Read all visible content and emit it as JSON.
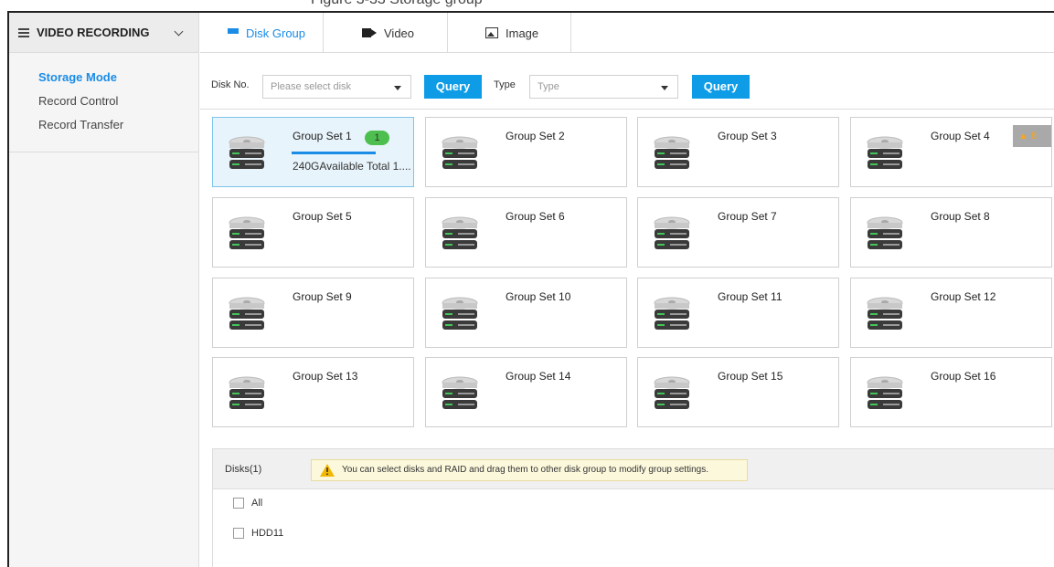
{
  "caption": "Figure 3-33 Storage group",
  "sidebar": {
    "title": "VIDEO RECORDING",
    "items": [
      {
        "label": "Storage Mode",
        "active": true
      },
      {
        "label": "Record Control",
        "active": false
      },
      {
        "label": "Record Transfer",
        "active": false
      }
    ]
  },
  "tabs": [
    {
      "label": "Disk Group",
      "icon": "list-icon",
      "active": true
    },
    {
      "label": "Video",
      "icon": "video-camera-icon",
      "active": false
    },
    {
      "label": "Image",
      "icon": "image-icon",
      "active": false
    }
  ],
  "filter": {
    "disk_label": "Disk No.",
    "disk_placeholder": "Please select disk",
    "query1": "Query",
    "type_label": "Type",
    "type_placeholder": "Type",
    "query2": "Query"
  },
  "groups": [
    {
      "name": "Group Set 1",
      "badge": "1",
      "subtext": "240GAvailable Total 1....",
      "selected": true
    },
    {
      "name": "Group Set 2"
    },
    {
      "name": "Group Set 3"
    },
    {
      "name": "Group Set 4",
      "warning": "8"
    },
    {
      "name": "Group Set 5"
    },
    {
      "name": "Group Set 6"
    },
    {
      "name": "Group Set 7"
    },
    {
      "name": "Group Set 8"
    },
    {
      "name": "Group Set 9"
    },
    {
      "name": "Group Set 10"
    },
    {
      "name": "Group Set 11"
    },
    {
      "name": "Group Set 12"
    },
    {
      "name": "Group Set 13"
    },
    {
      "name": "Group Set 14"
    },
    {
      "name": "Group Set 15"
    },
    {
      "name": "Group Set 16"
    }
  ],
  "disks": {
    "title": "Disks(1)",
    "tip": "You can select disks and RAID and drag them to other disk group to modify group settings.",
    "items": [
      {
        "label": "All"
      },
      {
        "label": "HDD11"
      }
    ]
  },
  "colors": {
    "accent": "#1a8ce6",
    "query_button": "#0f9ce6",
    "badge_green": "#4cbf4e",
    "warning_orange": "#f5a623"
  }
}
